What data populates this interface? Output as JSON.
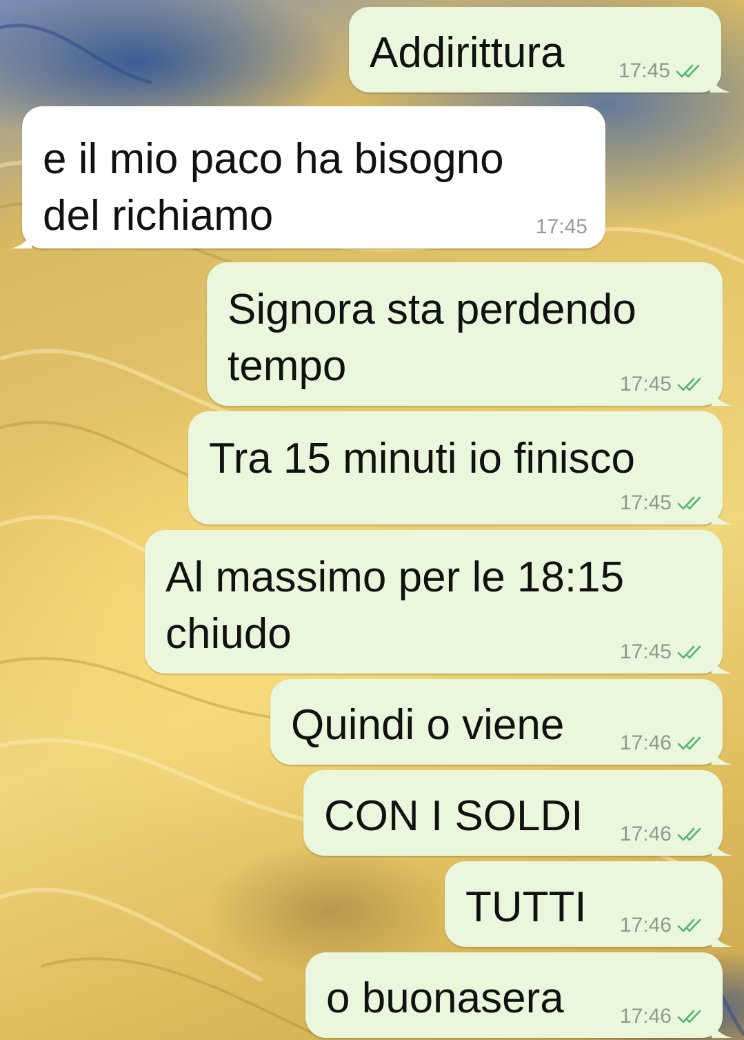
{
  "colors": {
    "outgoing_bubble": "#ebf7dd",
    "incoming_bubble": "#ffffff",
    "read_tick": "#4fb66a"
  },
  "messages": [
    {
      "direction": "outgoing",
      "text": "Addirittura",
      "time": "17:45",
      "status": "read-ticks-icon"
    },
    {
      "direction": "incoming",
      "text": "e il mio paco ha bisogno\ndel richiamo",
      "time": "17:45"
    },
    {
      "direction": "outgoing",
      "text": "Signora sta perdendo\ntempo",
      "time": "17:45",
      "status": "read-ticks-icon"
    },
    {
      "direction": "outgoing",
      "text": "Tra 15 minuti io finisco",
      "time": "17:45",
      "status": "read-ticks-icon"
    },
    {
      "direction": "outgoing",
      "text": "Al massimo per le 18:15\nchiudo",
      "time": "17:45",
      "status": "read-ticks-icon"
    },
    {
      "direction": "outgoing",
      "text": "Quindi o viene",
      "time": "17:46",
      "status": "read-ticks-icon"
    },
    {
      "direction": "outgoing",
      "text": "CON I SOLDI",
      "time": "17:46",
      "status": "read-ticks-icon"
    },
    {
      "direction": "outgoing",
      "text": "TUTTI",
      "time": "17:46",
      "status": "read-ticks-icon"
    },
    {
      "direction": "outgoing",
      "text": "o buonasera",
      "time": "17:46",
      "status": "read-ticks-icon"
    }
  ]
}
